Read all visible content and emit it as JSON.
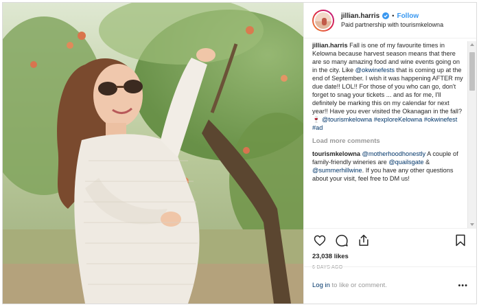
{
  "header": {
    "username": "jillian.harris",
    "follow_label": "Follow",
    "separator": "•",
    "partnership": "Paid partnership with tourismkelowna"
  },
  "caption": {
    "author": "jillian.harris",
    "t1": " Fall is one of my favourite times in Kelowna because harvest season means that there are so many amazing food and wine events going on in the city. Like ",
    "m1": "@okwinefests",
    "t2": " that is coming up at the end of September. I wish it was happening AFTER my due date!! LOL!! For those of you who can go, don't forget to snag your tickets ... and as for me, I'll definitely be marking this on my calendar for next year!! Have you ever visited the Okanagan in the fall?",
    "emoji": "🍷",
    "t3": " ",
    "m2": "@tourismkelowna",
    "h1": "#exploreKelowna",
    "h2": "#okwinefest",
    "h3": "#ad"
  },
  "load_more": "Load more comments",
  "reply": {
    "author": "tourismkelowna",
    "m1": "@motherhoodhonestly",
    "t1": " A couple of family-friendly wineries are ",
    "m2": "@quailsgate",
    "t2": " & ",
    "m3": "@summerhillwine",
    "t3": ". If you have any other questions about your visit, feel free to DM us!"
  },
  "likes": "23,038 likes",
  "date": "6 DAYS AGO",
  "login": {
    "link": "Log in",
    "rest": " to like or comment."
  },
  "more_label": "•••",
  "icons": [
    "heart-icon",
    "comment-icon",
    "share-icon",
    "bookmark-icon",
    "verified-badge-icon"
  ],
  "colors": {
    "link": "#003569",
    "follow": "#3897f0",
    "verified": "#3897f0",
    "muted": "#999999"
  }
}
